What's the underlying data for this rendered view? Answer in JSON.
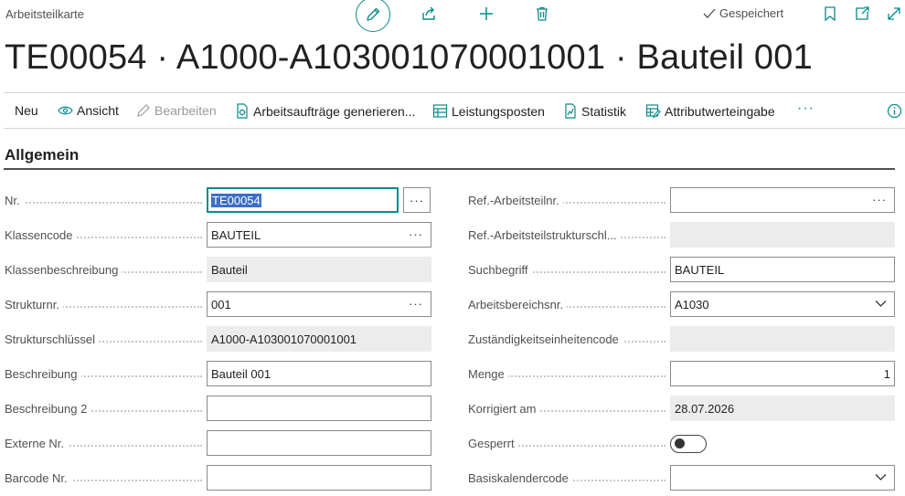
{
  "header": {
    "page_type": "Arbeitsteilkarte",
    "saved_label": "Gespeichert",
    "title": "TE00054 · A1000-A103001070001001 · Bauteil 001"
  },
  "actions": {
    "new": "Neu",
    "view": "Ansicht",
    "edit": "Bearbeiten",
    "generate_orders": "Arbeitsaufträge generieren...",
    "ledger_entries": "Leistungsposten",
    "statistics": "Statistik",
    "attribute_entry": "Attributwerteingabe",
    "more": "···"
  },
  "section": {
    "title": "Allgemein"
  },
  "left_fields": [
    {
      "label": "Nr.",
      "value": "TE00054"
    },
    {
      "label": "Klassencode",
      "value": "BAUTEIL"
    },
    {
      "label": "Klassenbeschreibung",
      "value": "Bauteil"
    },
    {
      "label": "Strukturnr.",
      "value": "001"
    },
    {
      "label": "Strukturschlüssel",
      "value": "A1000-A103001070001001"
    },
    {
      "label": "Beschreibung",
      "value": "Bauteil 001"
    },
    {
      "label": "Beschreibung 2",
      "value": ""
    },
    {
      "label": "Externe Nr.",
      "value": ""
    },
    {
      "label": "Barcode Nr.",
      "value": ""
    }
  ],
  "right_fields": [
    {
      "label": "Ref.-Arbeitsteilnr.",
      "value": ""
    },
    {
      "label": "Ref.-Arbeitsteilstrukturschl...",
      "value": ""
    },
    {
      "label": "Suchbegriff",
      "value": "BAUTEIL"
    },
    {
      "label": "Arbeitsbereichsnr.",
      "value": "A1030"
    },
    {
      "label": "Zuständigkeitseinheitencode",
      "value": ""
    },
    {
      "label": "Menge",
      "value": "1"
    },
    {
      "label": "Korrigiert am",
      "value": "28.07.2026"
    },
    {
      "label": "Gesperrt",
      "value": ""
    },
    {
      "label": "Basiskalendercode",
      "value": ""
    }
  ],
  "colors": {
    "accent": "#0a8a8a",
    "selection": "#3b6fc7",
    "readonly_bg": "#ececec"
  },
  "controls": {
    "blocked_toggle_on": false
  }
}
